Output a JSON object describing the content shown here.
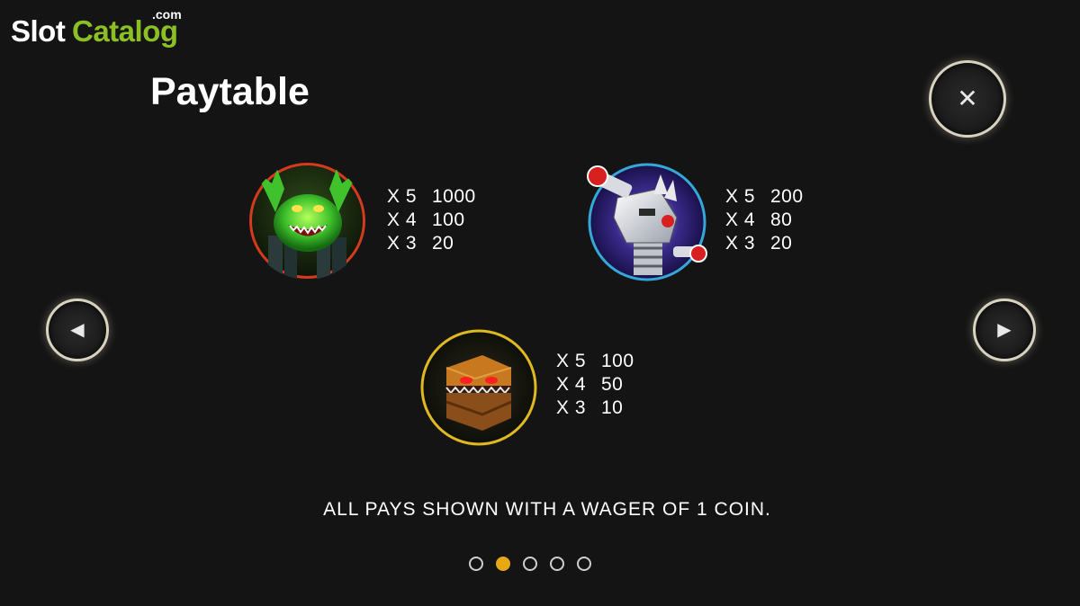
{
  "logo": {
    "part1": "Slot",
    "part2": "Catalog",
    "suffix": ".com"
  },
  "title": "Paytable",
  "icons": {
    "close": "close-icon",
    "prev": "arrow-left-icon",
    "next": "arrow-right-icon"
  },
  "symbols": [
    {
      "name": "green-monster",
      "pays": [
        {
          "mult": "X 5",
          "value": "1000"
        },
        {
          "mult": "X 4",
          "value": "100"
        },
        {
          "mult": "X 3",
          "value": "20"
        }
      ]
    },
    {
      "name": "robot",
      "pays": [
        {
          "mult": "X 5",
          "value": "200"
        },
        {
          "mult": "X 4",
          "value": "80"
        },
        {
          "mult": "X 3",
          "value": "20"
        }
      ]
    },
    {
      "name": "monster-cake",
      "pays": [
        {
          "mult": "X 5",
          "value": "100"
        },
        {
          "mult": "X 4",
          "value": "50"
        },
        {
          "mult": "X 3",
          "value": "10"
        }
      ]
    }
  ],
  "footnote": "ALL PAYS SHOWN WITH A WAGER OF 1 COIN.",
  "pagination": {
    "total": 5,
    "active_index": 1
  },
  "colors": {
    "accent": "#e8a815",
    "brand_green": "#8cbf26",
    "background": "#141414"
  }
}
